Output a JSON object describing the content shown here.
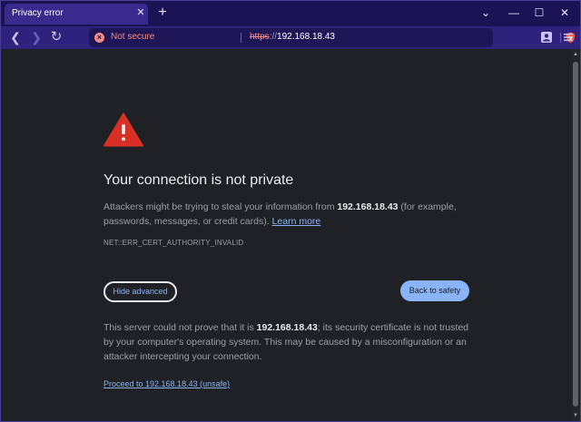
{
  "tab": {
    "title": "Privacy error",
    "close": "✕"
  },
  "newtab": "+",
  "window": {
    "dropdown": "⌄",
    "minimize": "—",
    "maximize": "☐",
    "close": "✕"
  },
  "nav": {
    "back": "❮",
    "forward": "❯",
    "reload": "↻"
  },
  "omnibox": {
    "status": "Not secure",
    "scheme": "https",
    "separator": "://",
    "host": "192.168.18.43"
  },
  "page": {
    "title": "Your connection is not private",
    "desc_before": "Attackers might be trying to steal your information from ",
    "desc_host": "192.168.18.43",
    "desc_after": " (for example, passwords, messages, or credit cards). ",
    "learn_more": "Learn more",
    "error_code": "NET::ERR_CERT_AUTHORITY_INVALID",
    "hide_advanced": "Hide advanced",
    "back_to_safety": "Back to safety",
    "detail_before": "This server could not prove that it is ",
    "detail_host": "192.168.18.43",
    "detail_after": "; its security certificate is not trusted by your computer's operating system. This may be caused by a misconfiguration or an attacker intercepting your connection.",
    "proceed": "Proceed to 192.168.18.43 (unsafe)"
  },
  "colors": {
    "warning_red": "#d93025",
    "link_blue": "#8ab4f8",
    "tab_strip": "#1c1354",
    "toolbar": "#2f227c",
    "page_bg": "#202124"
  },
  "icons": [
    "warning-triangle-icon",
    "not-secure-icon",
    "brave-shield-icon",
    "profile-icon",
    "menu-icon"
  ]
}
